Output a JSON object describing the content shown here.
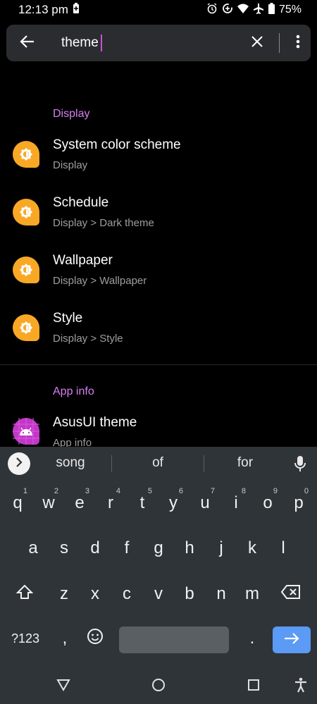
{
  "status": {
    "time": "12:13 pm",
    "battery": "75%",
    "icons": [
      "battery-saver-icon",
      "alarm-icon",
      "data-saver-icon",
      "wifi-icon",
      "airplane-icon",
      "battery-icon"
    ]
  },
  "search": {
    "query": "theme"
  },
  "sections": [
    {
      "title": "Display",
      "items": [
        {
          "title": "System color scheme",
          "subtitle": "Display",
          "icon": "brightness-icon"
        },
        {
          "title": "Schedule",
          "subtitle": "Display > Dark theme",
          "icon": "brightness-icon"
        },
        {
          "title": "Wallpaper",
          "subtitle": "Display > Wallpaper",
          "icon": "brightness-icon"
        },
        {
          "title": "Style",
          "subtitle": "Display > Style",
          "icon": "brightness-icon"
        }
      ]
    },
    {
      "title": "App info",
      "items": [
        {
          "title": "AsusUI theme",
          "subtitle": "App info",
          "icon": "android-icon"
        }
      ]
    }
  ],
  "keyboard": {
    "suggestions": [
      "song",
      "of",
      "for"
    ],
    "row1": [
      {
        "k": "q",
        "h": "1"
      },
      {
        "k": "w",
        "h": "2"
      },
      {
        "k": "e",
        "h": "3"
      },
      {
        "k": "r",
        "h": "4"
      },
      {
        "k": "t",
        "h": "5"
      },
      {
        "k": "y",
        "h": "6"
      },
      {
        "k": "u",
        "h": "7"
      },
      {
        "k": "i",
        "h": "8"
      },
      {
        "k": "o",
        "h": "9"
      },
      {
        "k": "p",
        "h": "0"
      }
    ],
    "row2": [
      "a",
      "s",
      "d",
      "f",
      "g",
      "h",
      "j",
      "k",
      "l"
    ],
    "row3": [
      "z",
      "x",
      "c",
      "v",
      "b",
      "n",
      "m"
    ],
    "symbols_label": "?123",
    "comma": ",",
    "period": "."
  },
  "colors": {
    "accent": "#d77ff0",
    "settings_icon": "#f9a825",
    "app_icon": "#c236c8",
    "enter_key": "#5b9af5"
  }
}
